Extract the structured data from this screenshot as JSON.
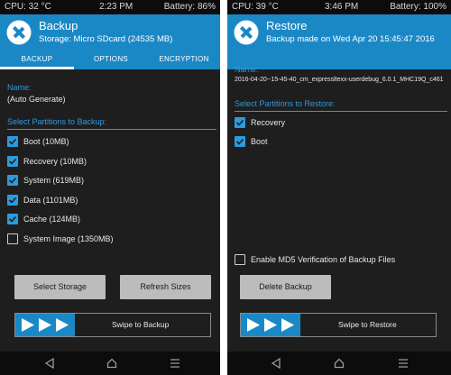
{
  "left": {
    "status": {
      "cpu": "CPU: 32 °C",
      "time": "2:23 PM",
      "battery": "Battery: 86%"
    },
    "header": {
      "title": "Backup",
      "subtitle": "Storage: Micro SDcard (24535 MB)"
    },
    "tabs": [
      {
        "label": "BACKUP",
        "active": true
      },
      {
        "label": "OPTIONS",
        "active": false
      },
      {
        "label": "ENCRYPTION",
        "active": false
      }
    ],
    "name_label": "Name:",
    "name_value": "(Auto Generate)",
    "section_title": "Select Partitions to Backup:",
    "partitions": [
      {
        "label": "Boot (10MB)",
        "checked": true
      },
      {
        "label": "Recovery (10MB)",
        "checked": true
      },
      {
        "label": "System (619MB)",
        "checked": true
      },
      {
        "label": "Data (1101MB)",
        "checked": true
      },
      {
        "label": "Cache (124MB)",
        "checked": true
      },
      {
        "label": "System Image (1350MB)",
        "checked": false
      }
    ],
    "buttons": {
      "select_storage": "Select Storage",
      "refresh_sizes": "Refresh Sizes"
    },
    "swipe_label": "Swipe to Backup"
  },
  "right": {
    "status": {
      "cpu": "CPU: 39 °C",
      "time": "3:46 PM",
      "battery": "Battery: 100%"
    },
    "header": {
      "title": "Restore",
      "subtitle": "Backup made on Wed Apr 20 15:45:47 2016"
    },
    "name_label": "Name:",
    "name_value": "2016-04-20--15-45-40_cm_expressltexx-userdebug_6.0.1_MHC19Q_c461",
    "section_title": "Select Partitions to Restore:",
    "partitions": [
      {
        "label": "Recovery",
        "checked": true
      },
      {
        "label": "Boot",
        "checked": true
      }
    ],
    "md5_label": "Enable MD5 Verification of Backup Files",
    "md5_checked": false,
    "buttons": {
      "delete_backup": "Delete Backup"
    },
    "swipe_label": "Swipe to Restore"
  },
  "colors": {
    "accent": "#1b88c6",
    "accent_light": "#2b9be0",
    "background": "#1e1e1e",
    "button": "#bcbcbc"
  },
  "icons": {
    "logo": "twrp-logo-icon",
    "checkbox_checked": "check-icon",
    "swipe_arrows": "triple-arrow-icon",
    "nav_back": "back-triangle-icon",
    "nav_home": "home-icon",
    "nav_menu": "menu-lines-icon"
  }
}
